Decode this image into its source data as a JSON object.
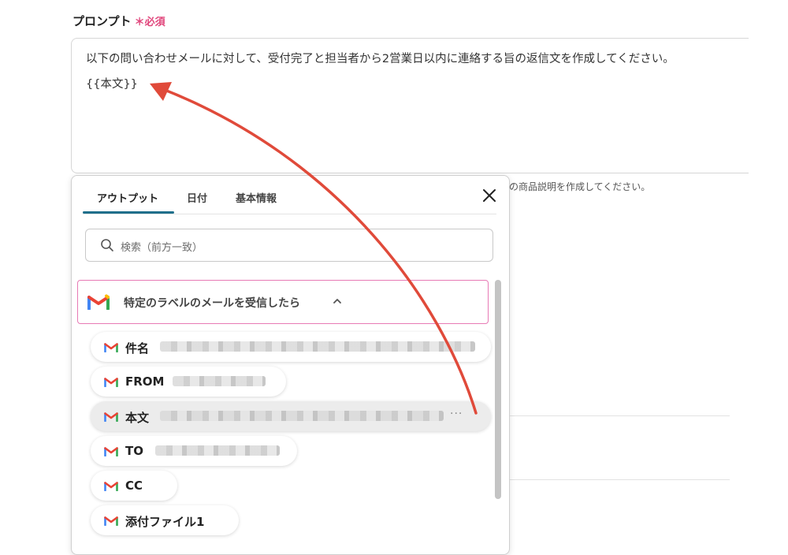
{
  "prompt": {
    "label": "プロンプト",
    "required": "＊必須",
    "line1": "以下の問い合わせメールに対して、受付完了と担当者から2営業日以内に連絡する旨の返信文を作成してください。",
    "line2": "{{本文}}"
  },
  "hint_text": "の商品説明を作成してください。",
  "panel": {
    "tabs": [
      {
        "label": "アウトプット",
        "active": true
      },
      {
        "label": "日付",
        "active": false
      },
      {
        "label": "基本情報",
        "active": false
      }
    ],
    "search_placeholder": "検索（前方一致）",
    "trigger_label": "特定のラベルのメールを受信したら",
    "items": [
      {
        "label": "件名"
      },
      {
        "label": "FROM"
      },
      {
        "label": "本文"
      },
      {
        "label": "TO"
      },
      {
        "label": "CC"
      },
      {
        "label": "添付ファイル1"
      }
    ]
  },
  "colors": {
    "required": "#e0457b",
    "tab_underline": "#1f6f8b",
    "trigger_border": "#e77ab5",
    "arrow": "#e04a3a"
  },
  "icons": {
    "close": "close-icon",
    "search": "search-icon",
    "gmail": "gmail-icon",
    "chevron": "chevron-up-icon"
  }
}
